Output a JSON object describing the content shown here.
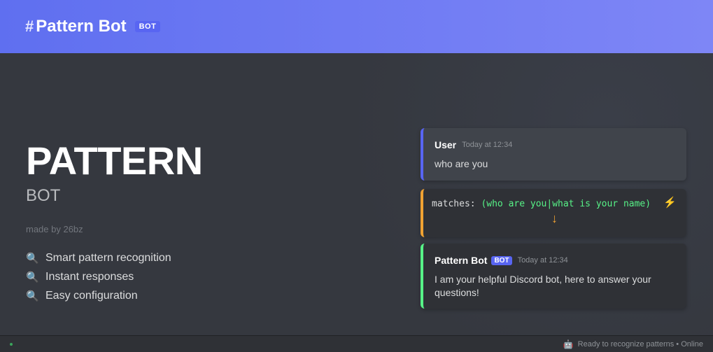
{
  "header": {
    "hash": "#",
    "title": "Pattern Bot",
    "badge": "BOT"
  },
  "hero": {
    "title": "PATTERN",
    "subtitle": "BOT",
    "credit": "made by 26bz",
    "features": [
      {
        "icon": "search-icon",
        "label": "Smart pattern recognition"
      },
      {
        "icon": "search-icon",
        "label": "Instant responses"
      },
      {
        "icon": "search-icon",
        "label": "Easy configuration"
      }
    ]
  },
  "chat": {
    "user_message": {
      "author": "User",
      "time": "Today at 12:34",
      "text": "who are you"
    },
    "match": {
      "label": "matches:",
      "pattern": "(who are you|what is your name)",
      "bolt_icon": "lightning-icon",
      "arrow_icon": "arrow-down-icon"
    },
    "bot_message": {
      "author": "Pattern Bot",
      "badge": "BOT",
      "time": "Today at 12:34",
      "text": "I am your helpful Discord bot, here to answer your questions!"
    }
  },
  "footer": {
    "status_icon": "robot-icon",
    "status_text": "Ready to recognize patterns • Online"
  },
  "colors": {
    "header_start": "#5f6ff0",
    "header_end": "#7e86f6",
    "background": "#36393f",
    "user_accent": "#5865f2",
    "match_accent": "#f0a232",
    "bot_accent": "#57f287",
    "regex_text": "#57f287"
  }
}
